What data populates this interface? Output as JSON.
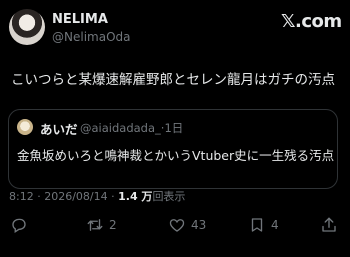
{
  "author": {
    "name": "NELIMA",
    "handle": "@NelimaOda"
  },
  "brand": {
    "label": "𝕏.com",
    "icon": "x-logo-icon"
  },
  "tweet": {
    "text": "こいつらと某爆速解雇野郎とセレン龍月はガチの汚点"
  },
  "quoted": {
    "name": "あいだ",
    "handle": "@aiaidadada_",
    "time": "1日",
    "text": "金魚坂めいろと鳴神裁とかいうVtuber史に一生残る汚点"
  },
  "meta": {
    "time": "8:12",
    "date": "2026/08/14",
    "views": "1.4 万",
    "views_suffix": "回表示"
  },
  "actions": {
    "reply": {
      "icon": "reply-icon",
      "count": ""
    },
    "retweet": {
      "icon": "retweet-icon",
      "count": "2"
    },
    "like": {
      "icon": "heart-icon",
      "count": "43"
    },
    "bookmark": {
      "icon": "bookmark-icon",
      "count": "4"
    },
    "share": {
      "icon": "share-icon",
      "count": ""
    }
  },
  "colors": {
    "background": "#000000",
    "text": "#e7e9ea",
    "muted": "#71767b",
    "border": "#2f3336"
  }
}
